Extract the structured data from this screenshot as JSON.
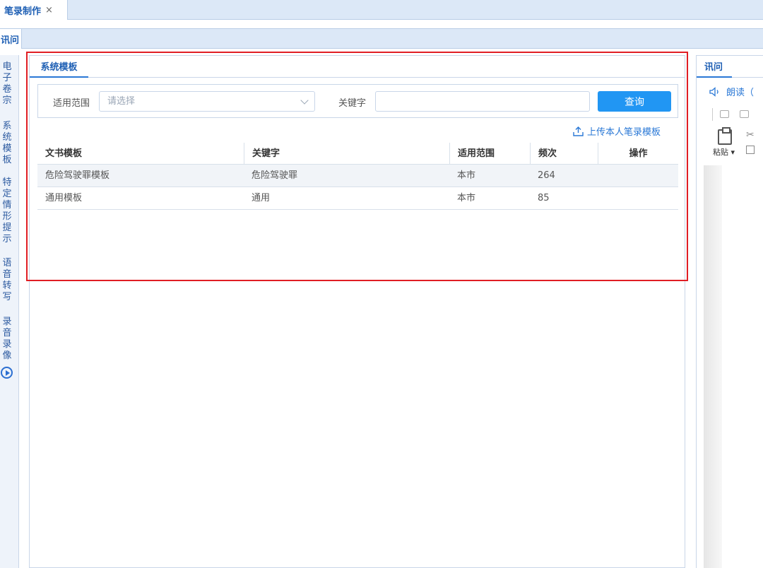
{
  "top_tab": {
    "label": "笔录制作",
    "close": "×"
  },
  "sub_tab": {
    "label": "讯问"
  },
  "left_menu": [
    {
      "label": "电子卷宗"
    },
    {
      "label": "系统模板"
    },
    {
      "label": "特定情形提示"
    },
    {
      "label": "语音转写"
    },
    {
      "label": "录音录像"
    }
  ],
  "panel": {
    "tab": "系统模板",
    "search": {
      "scope_label": "适用范围",
      "scope_placeholder": "请选择",
      "keyword_label": "关键字",
      "keyword_value": "",
      "query_button": "查询"
    },
    "upload_link": "上传本人笔录模板",
    "table": {
      "headers": [
        "文书模板",
        "关键字",
        "适用范围",
        "频次",
        "操作"
      ],
      "rows": [
        [
          "危险驾驶罪模板",
          "危险驾驶罪",
          "本市",
          "264",
          ""
        ],
        [
          "通用模板",
          "通用",
          "本市",
          "85",
          ""
        ]
      ]
    }
  },
  "right_panel": {
    "tab": "讯问",
    "read_label": "朗读（",
    "paste_label": "粘贴"
  },
  "colors": {
    "accent": "#2196f3",
    "highlight": "#e01e24",
    "tab_blue": "#1e5fb4"
  }
}
